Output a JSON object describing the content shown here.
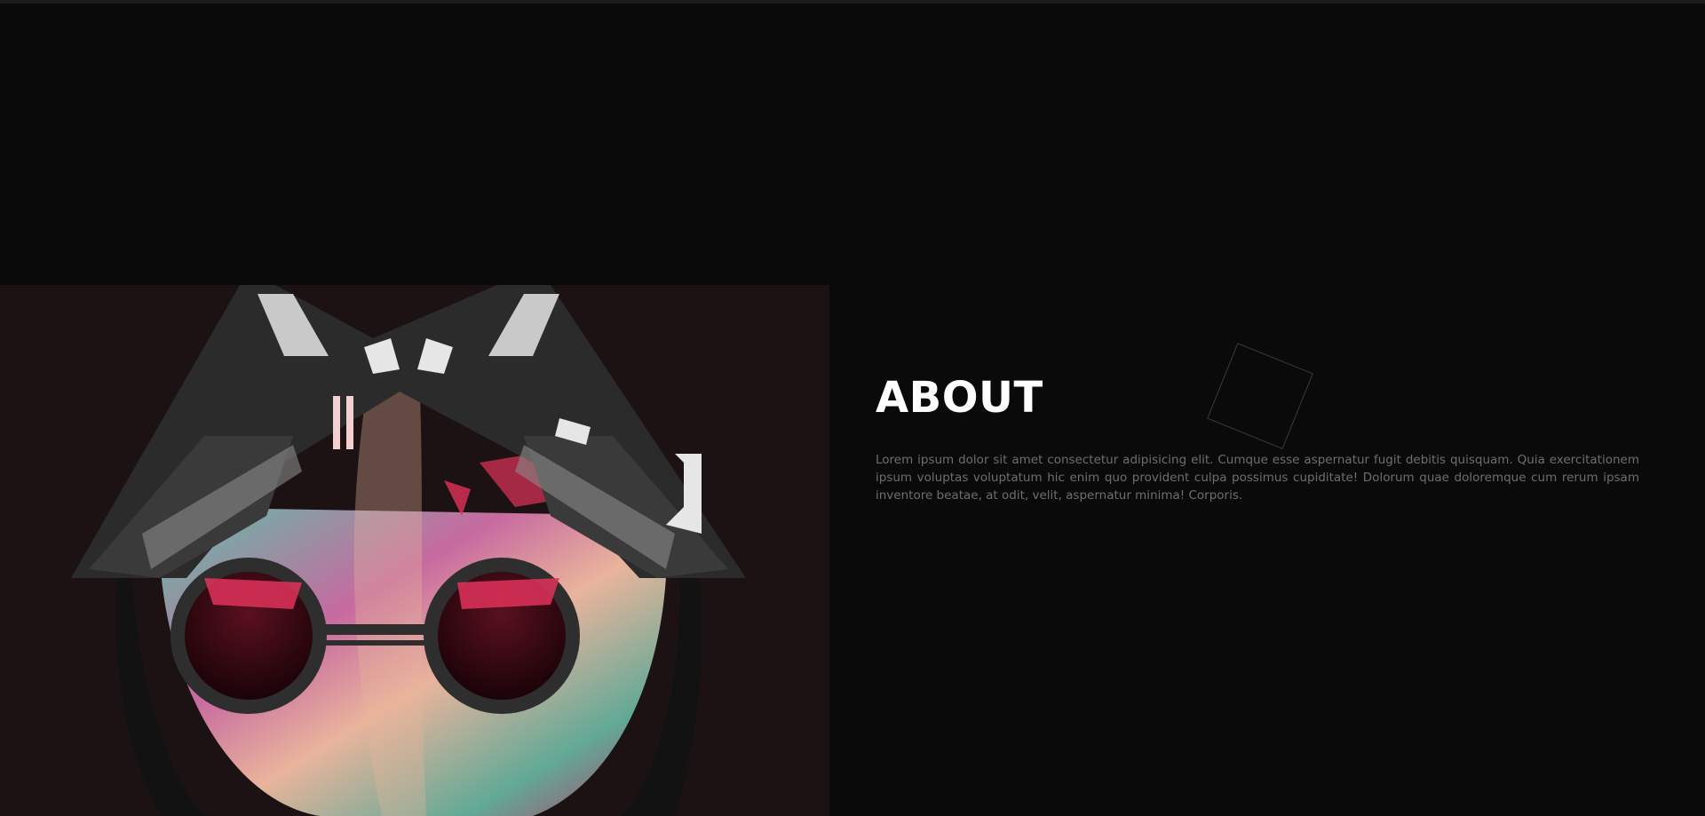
{
  "about": {
    "title": "ABOUT",
    "text": "Lorem ipsum dolor sit amet consectetur adipisicing elit. Cumque esse aspernatur fugit debitis quisquam. Quia exercitationem ipsum voluptas voluptatum hic enim quo provident culpa possimus cupiditate! Dolorum quae doloremque cum rerum ipsam inventore beatae, at odit, velit, aspernatur minima! Corporis."
  },
  "colors": {
    "page_background": "#0a0a0a",
    "art_background": "#1c1213",
    "title": "#ffffff",
    "body_text": "#6e6e6e",
    "accent_pink": "#e0325a",
    "accent_teal": "#5fbfa6"
  },
  "icons": {
    "decoration": "outline-square-icon"
  }
}
